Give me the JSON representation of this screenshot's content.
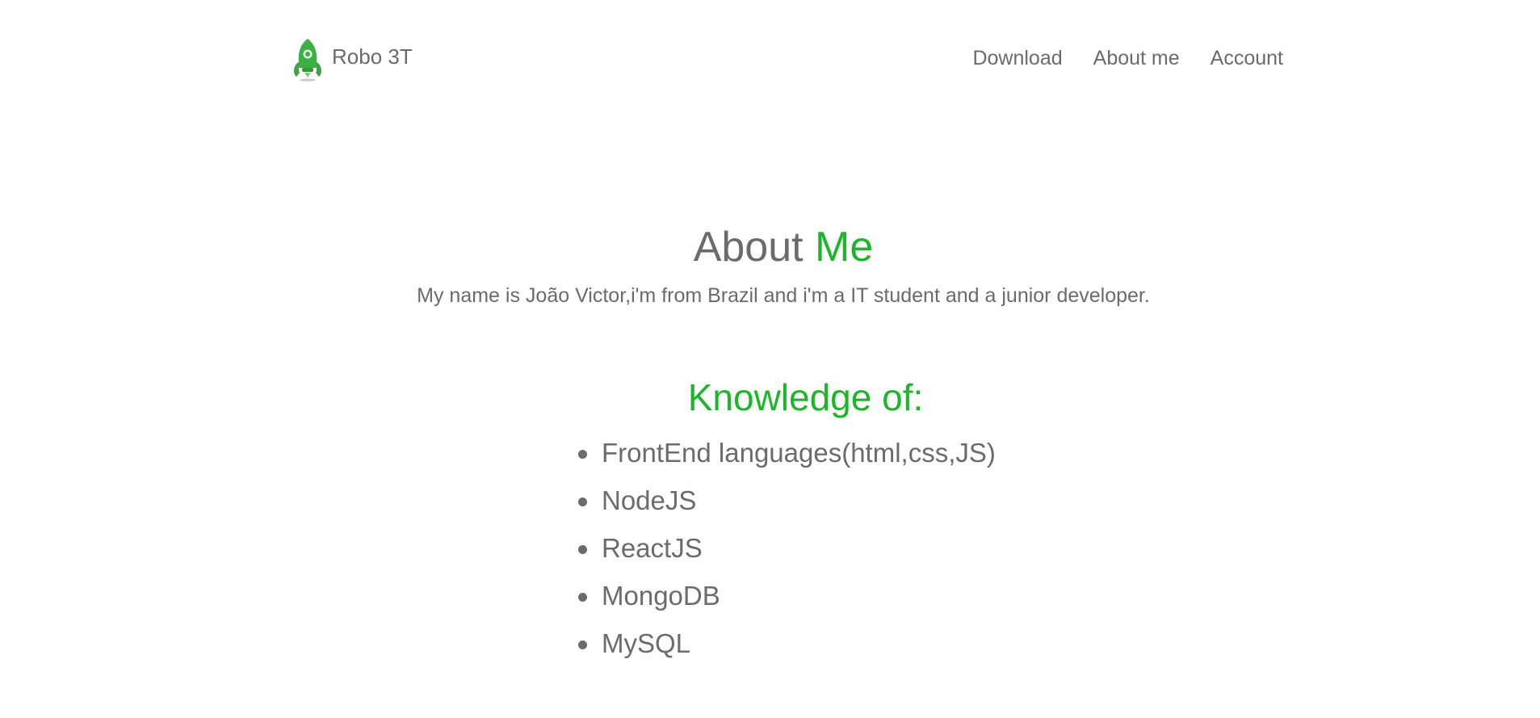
{
  "header": {
    "brand_name": "Robo 3T",
    "logo_icon": "robo-3t-rocket-logo",
    "nav": [
      {
        "label": "Download"
      },
      {
        "label": "About me"
      },
      {
        "label": "Account"
      }
    ]
  },
  "about": {
    "title_prefix": "About ",
    "title_highlight": "Me",
    "description": "My name is João Victor,i'm from Brazil and i'm a IT student and a junior developer."
  },
  "knowledge": {
    "title": "Knowledge of:",
    "items": [
      "FrontEnd languages(html,css,JS)",
      "NodeJS",
      "ReactJS",
      "MongoDB",
      "MySQL"
    ]
  },
  "colors": {
    "accent": "#1db529",
    "text": "#6b6b6b",
    "background": "#ffffff"
  }
}
